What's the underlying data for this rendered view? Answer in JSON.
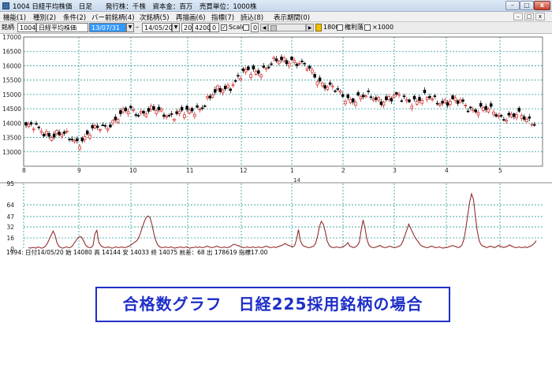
{
  "window": {
    "title": "1004 日経平均株価　日足　　発行株：千株　資本金：百万　売買単位：1000株",
    "min_glyph": "–",
    "max_glyph": "□",
    "close_glyph": "x"
  },
  "menu": {
    "items": [
      "機能(1)",
      "種別(2)",
      "条件(2)",
      "バー",
      "前銘柄(4)",
      "次銘柄(5)",
      "再描画(6)",
      "指標(7)",
      "読込(8)",
      "表示期間(0)"
    ],
    "right_buttons": [
      "–",
      "□",
      "x"
    ]
  },
  "toolbar": {
    "code_label": "銘柄",
    "code_value": "1004",
    "name_value": "日経平均株価",
    "start_date": "13/07/31",
    "dash": "–",
    "end_date": "14/05/20",
    "field_a": "20",
    "field_b": "4200",
    "field_c": "0",
    "scale_label": "Scale",
    "scale_value": "0",
    "value_1800": "1800",
    "adjust_label": "権利落",
    "x1000_label": "×1000"
  },
  "price_panel": {
    "y_ticks": [
      "17000",
      "16500",
      "16000",
      "15500",
      "15000",
      "14500",
      "14000",
      "13500",
      "13000"
    ],
    "month_labels": [
      "8",
      "9",
      "10",
      "11",
      "12",
      "1",
      "2",
      "3",
      "4",
      "5"
    ],
    "year_label": "14"
  },
  "indicator_panel": {
    "y_ticks": [
      "95",
      "64",
      "47",
      "32",
      "16",
      "0"
    ],
    "status_line": "1994:  日付14/05/20  始 14080  高 14144  安 14033  終 14075  前差：68  出 178619  指標17.00"
  },
  "chart_data": {
    "type": "line",
    "title": "",
    "panels": [
      {
        "name": "price",
        "type": "candlestick",
        "ylim": [
          12500,
          17000
        ],
        "x_labels": [
          "8",
          "9",
          "10",
          "11",
          "12",
          "1",
          "2",
          "3",
          "4",
          "5"
        ],
        "year_label": "14",
        "monthly_closes": [
          {
            "month": "8",
            "close": 13400
          },
          {
            "month": "9",
            "close": 14450
          },
          {
            "month": "10",
            "close": 14300
          },
          {
            "month": "11",
            "close": 15650
          },
          {
            "month": "12",
            "close": 16280
          },
          {
            "month": "1",
            "close": 14900
          },
          {
            "month": "2",
            "close": 14850
          },
          {
            "month": "3",
            "close": 14800
          },
          {
            "month": "4",
            "close": 14300
          },
          {
            "month": "5",
            "close": 14075
          }
        ],
        "last_bar": {
          "date": "14/05/20",
          "open": 14080,
          "high": 14144,
          "low": 14033,
          "close": 14075,
          "change": 68,
          "volume": 178619
        }
      },
      {
        "name": "合格数",
        "type": "line",
        "ylim": [
          0,
          95
        ],
        "y_ticks": [
          0,
          16,
          32,
          47,
          64,
          95
        ],
        "color": "#8b1a1a",
        "values": [
          2,
          1,
          2,
          2,
          1,
          3,
          2,
          1,
          2,
          4,
          8,
          14,
          20,
          26,
          20,
          9,
          4,
          2,
          1,
          2,
          3,
          2,
          2,
          4,
          8,
          12,
          16,
          18,
          17,
          12,
          6,
          3,
          2,
          2,
          5,
          22,
          27,
          10,
          5,
          3,
          2,
          2,
          3,
          2,
          1,
          2,
          3,
          2,
          2,
          3,
          2,
          2,
          3,
          4,
          6,
          8,
          10,
          12,
          16,
          24,
          32,
          40,
          46,
          48,
          45,
          35,
          22,
          12,
          6,
          3,
          2,
          2,
          3,
          2,
          2,
          3,
          2,
          1,
          2,
          2,
          3,
          2,
          2,
          3,
          2,
          1,
          2,
          2,
          3,
          2,
          3,
          2,
          2,
          3,
          4,
          3,
          2,
          2,
          3,
          4,
          3,
          2,
          2,
          3,
          2,
          2,
          3,
          5,
          7,
          6,
          5,
          4,
          3,
          2,
          2,
          3,
          2,
          2,
          3,
          2,
          2,
          3,
          2,
          2,
          3,
          4,
          3,
          2,
          2,
          3,
          2,
          3,
          4,
          5,
          6,
          8,
          6,
          5,
          4,
          3,
          5,
          14,
          28,
          12,
          6,
          4,
          3,
          2,
          2,
          3,
          4,
          8,
          18,
          32,
          40,
          36,
          26,
          12,
          6,
          3,
          2,
          2,
          3,
          2,
          2,
          3,
          4,
          6,
          9,
          4,
          3,
          2,
          3,
          5,
          10,
          28,
          42,
          30,
          14,
          6,
          3,
          2,
          2,
          3,
          4,
          5,
          3,
          2,
          2,
          3,
          4,
          3,
          2,
          2,
          3,
          4,
          6,
          12,
          20,
          28,
          36,
          30,
          24,
          18,
          14,
          10,
          6,
          4,
          3,
          2,
          2,
          3,
          4,
          3,
          2,
          2,
          3,
          2,
          1,
          2,
          2,
          3,
          4,
          5,
          4,
          3,
          2,
          3,
          6,
          14,
          30,
          50,
          68,
          80,
          72,
          48,
          26,
          12,
          6,
          4,
          3,
          2,
          3,
          4,
          3,
          2,
          3,
          5,
          4,
          3,
          2,
          3,
          4,
          6,
          4,
          3,
          2,
          2,
          3,
          2,
          2,
          3,
          2,
          3,
          4,
          6,
          8,
          12
        ]
      }
    ]
  },
  "caption": {
    "text": "合格数グラフ　日経225採用銘柄の場合",
    "color": "#1e2fc8"
  }
}
